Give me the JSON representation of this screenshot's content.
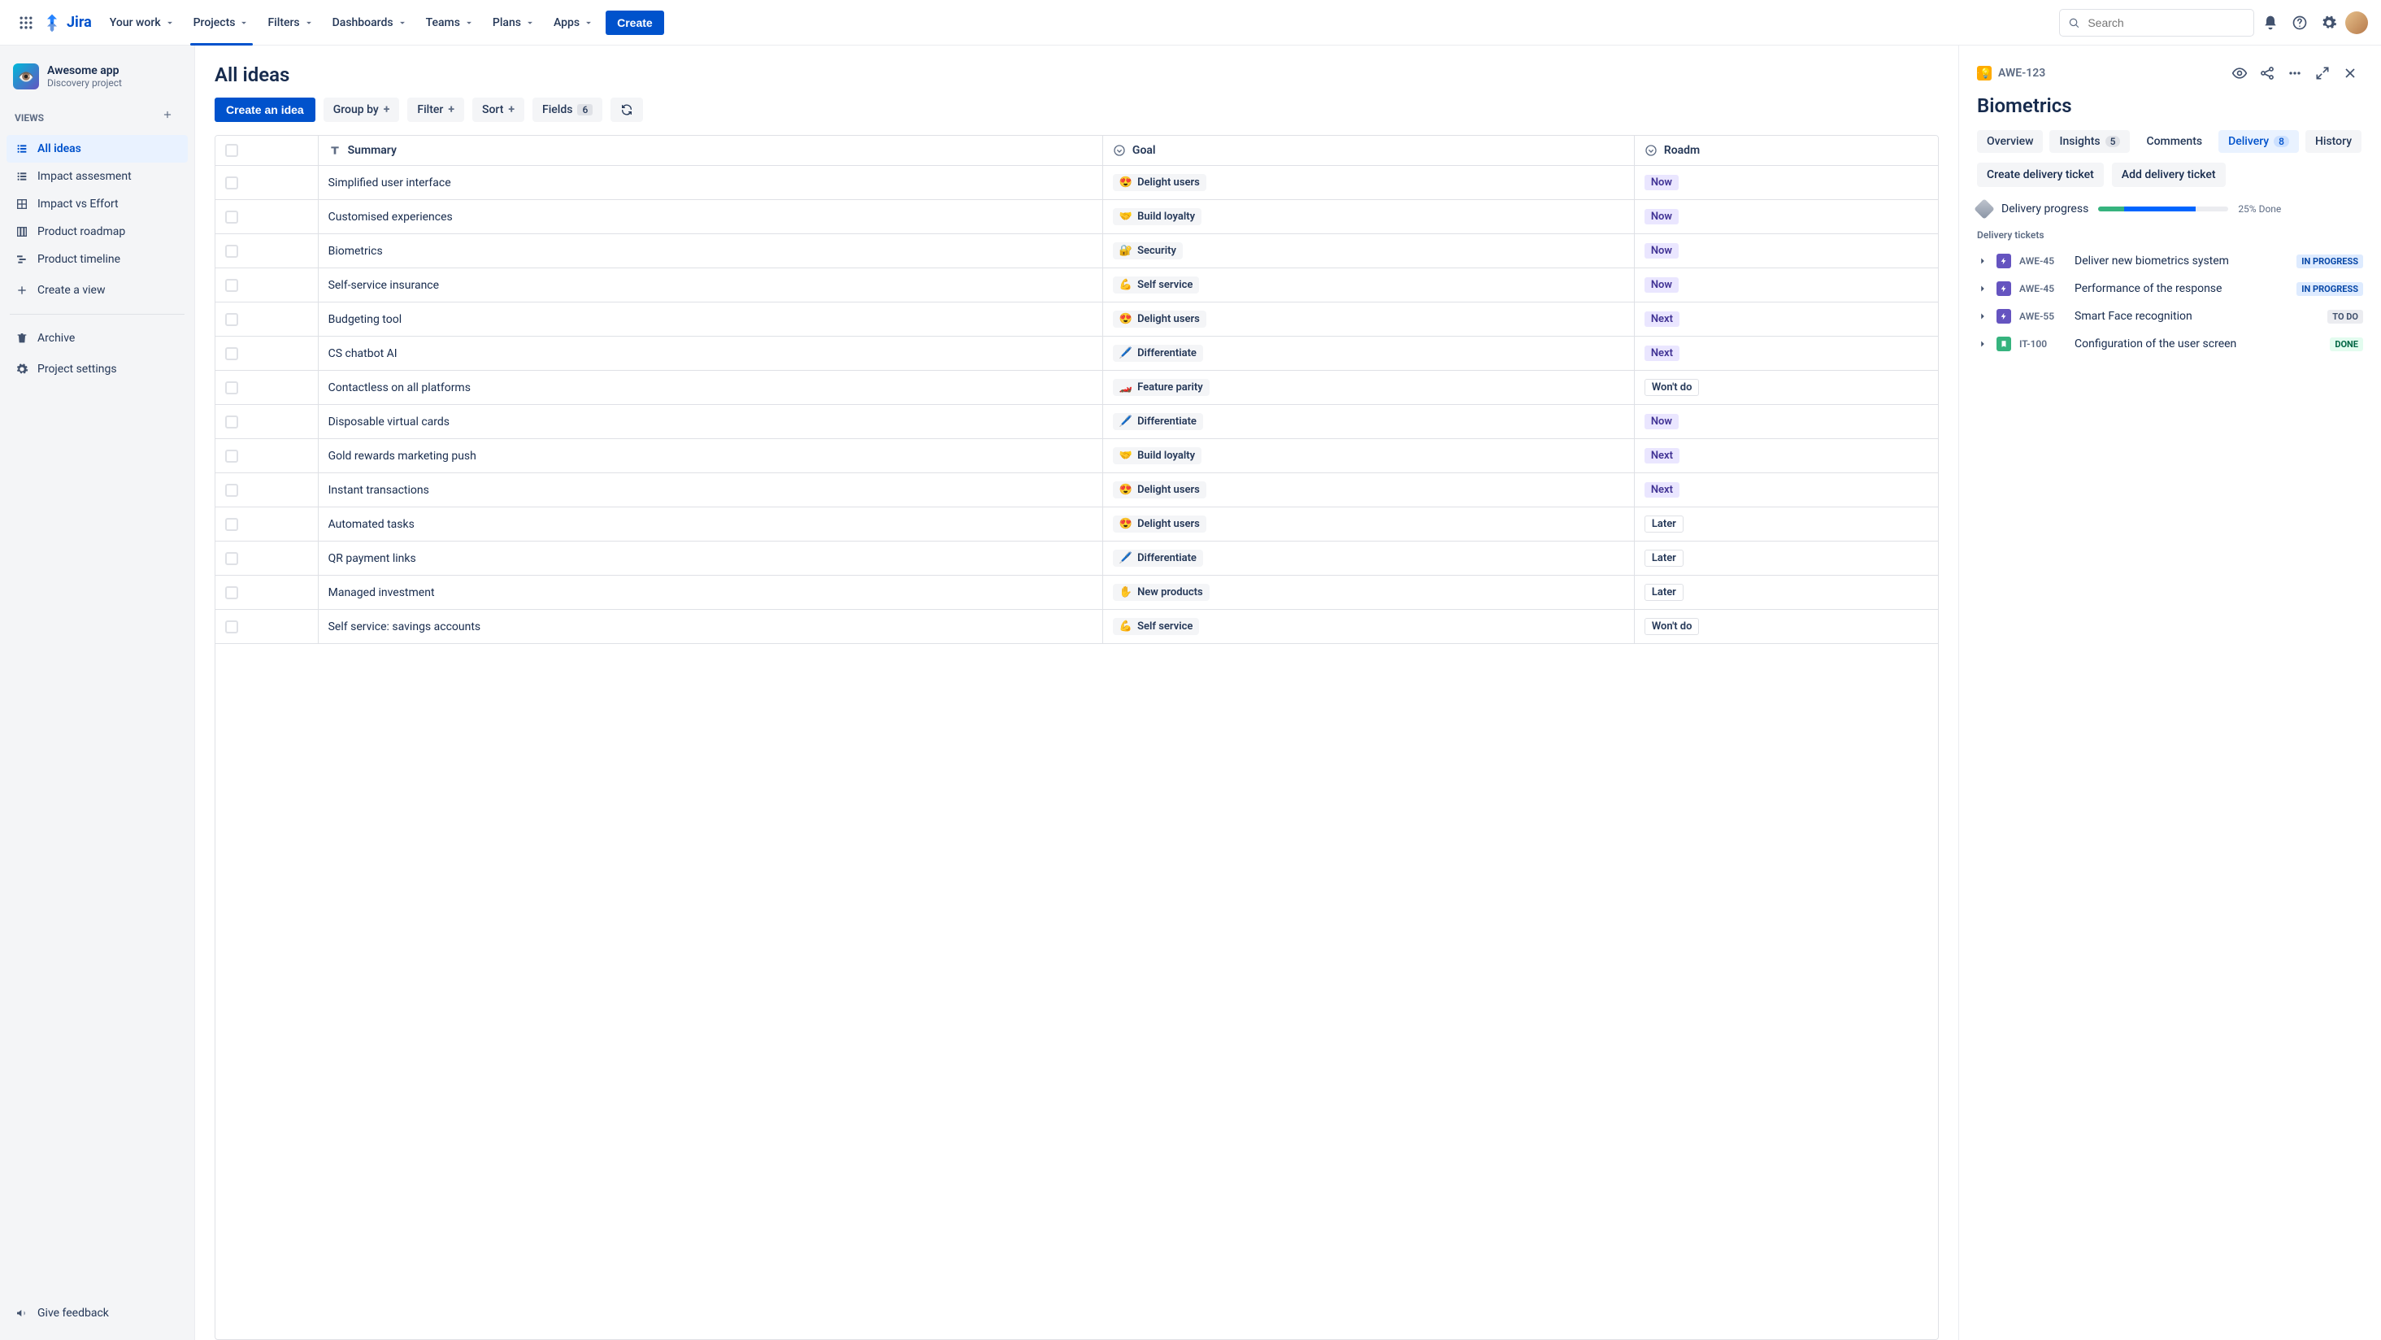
{
  "nav": {
    "brand": "Jira",
    "items": [
      "Your work",
      "Projects",
      "Filters",
      "Dashboards",
      "Teams",
      "Plans",
      "Apps"
    ],
    "active_index": 1,
    "create": "Create",
    "search_placeholder": "Search"
  },
  "sidebar": {
    "project_title": "Awesome app",
    "project_subtitle": "Discovery project",
    "views_label": "VIEWS",
    "views": [
      {
        "label": "All ideas",
        "icon": "list"
      },
      {
        "label": "Impact assesment",
        "icon": "list"
      },
      {
        "label": "Impact vs Effort",
        "icon": "matrix"
      },
      {
        "label": "Product roadmap",
        "icon": "board"
      },
      {
        "label": "Product timeline",
        "icon": "timeline"
      }
    ],
    "active_view_index": 0,
    "create_view": "Create a view",
    "archive": "Archive",
    "settings": "Project settings",
    "feedback": "Give feedback"
  },
  "main": {
    "title": "All ideas",
    "create_idea": "Create an idea",
    "toolbar": {
      "group_by": "Group by",
      "filter": "Filter",
      "sort": "Sort",
      "fields": "Fields",
      "fields_count": "6"
    },
    "columns": {
      "summary": "Summary",
      "goal": "Goal",
      "roadmap": "Roadm"
    },
    "rows": [
      {
        "summary": "Simplified user interface",
        "goal": {
          "emoji": "😍",
          "text": "Delight users"
        },
        "road": "Now"
      },
      {
        "summary": "Customised experiences",
        "goal": {
          "emoji": "🤝",
          "text": "Build loyalty"
        },
        "road": "Now"
      },
      {
        "summary": "Biometrics",
        "goal": {
          "emoji": "🔐",
          "text": "Security"
        },
        "road": "Now"
      },
      {
        "summary": "Self-service insurance",
        "goal": {
          "emoji": "💪",
          "text": "Self service"
        },
        "road": "Now"
      },
      {
        "summary": "Budgeting tool",
        "goal": {
          "emoji": "😍",
          "text": "Delight users"
        },
        "road": "Next"
      },
      {
        "summary": "CS chatbot AI",
        "goal": {
          "emoji": "🖊️",
          "text": "Differentiate"
        },
        "road": "Next"
      },
      {
        "summary": "Contactless on all platforms",
        "goal": {
          "emoji": "🏎️",
          "text": "Feature parity"
        },
        "road": "Won't do"
      },
      {
        "summary": "Disposable virtual cards",
        "goal": {
          "emoji": "🖊️",
          "text": "Differentiate"
        },
        "road": "Now"
      },
      {
        "summary": "Gold rewards marketing push",
        "goal": {
          "emoji": "🤝",
          "text": "Build loyalty"
        },
        "road": "Next"
      },
      {
        "summary": "Instant transactions",
        "goal": {
          "emoji": "😍",
          "text": "Delight users"
        },
        "road": "Next"
      },
      {
        "summary": "Automated tasks",
        "goal": {
          "emoji": "😍",
          "text": "Delight users"
        },
        "road": "Later"
      },
      {
        "summary": "QR payment links",
        "goal": {
          "emoji": "🖊️",
          "text": "Differentiate"
        },
        "road": "Later"
      },
      {
        "summary": "Managed investment",
        "goal": {
          "emoji": "✋",
          "text": "New products"
        },
        "road": "Later"
      },
      {
        "summary": "Self service: savings accounts",
        "goal": {
          "emoji": "💪",
          "text": "Self service"
        },
        "road": "Won't do"
      }
    ]
  },
  "detail": {
    "key": "AWE-123",
    "title": "Biometrics",
    "tabs": [
      {
        "label": "Overview"
      },
      {
        "label": "Insights",
        "count": "5"
      },
      {
        "label": "Comments"
      },
      {
        "label": "Delivery",
        "count": "8"
      },
      {
        "label": "History"
      }
    ],
    "active_tab_index": 3,
    "buttons": {
      "create": "Create delivery ticket",
      "add": "Add delivery ticket"
    },
    "progress_label": "Delivery progress",
    "progress_text": "25% Done",
    "progress": {
      "green": 20,
      "blue": 55
    },
    "tickets_label": "Delivery tickets",
    "tickets": [
      {
        "icon": "purple",
        "key": "AWE-45",
        "title": "Deliver new biometrics system",
        "status": "IN PROGRESS",
        "status_kind": "inprog"
      },
      {
        "icon": "purple",
        "key": "AWE-45",
        "title": "Performance of the response",
        "status": "IN PROGRESS",
        "status_kind": "inprog"
      },
      {
        "icon": "purple",
        "key": "AWE-55",
        "title": "Smart Face recognition",
        "status": "TO DO",
        "status_kind": "todo"
      },
      {
        "icon": "green",
        "key": "IT-100",
        "title": "Configuration of the user screen",
        "status": "DONE",
        "status_kind": "done"
      }
    ]
  }
}
